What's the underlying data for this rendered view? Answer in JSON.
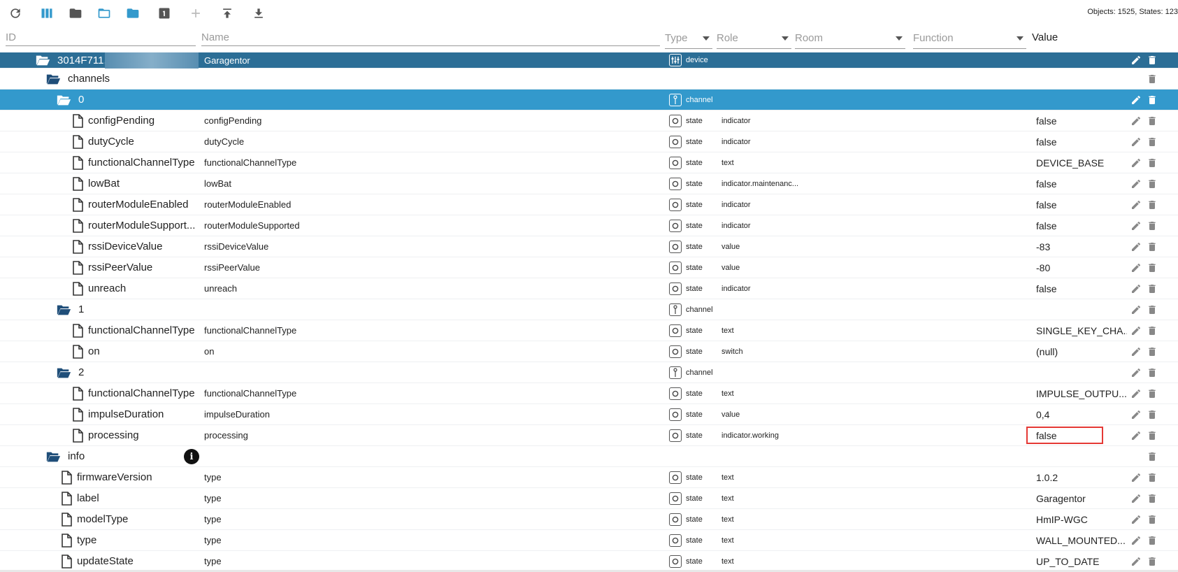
{
  "toolbar": {
    "buttons": [
      {
        "name": "refresh-button",
        "icon": "refresh-icon"
      },
      {
        "name": "columns-button",
        "icon": "columns-icon"
      },
      {
        "name": "folder-button",
        "icon": "folder-icon"
      },
      {
        "name": "folder-open-button",
        "icon": "folder-open-icon"
      },
      {
        "name": "folder-blue-button",
        "icon": "folder-icon"
      },
      {
        "name": "depth-button",
        "icon": "one-box-icon"
      },
      {
        "name": "add-button",
        "icon": "plus-icon"
      },
      {
        "name": "upload-button",
        "icon": "upload-icon"
      },
      {
        "name": "download-button",
        "icon": "download-icon"
      }
    ],
    "object_count": "Objects: 1525, States: 123"
  },
  "header": {
    "id_placeholder": "ID",
    "name_placeholder": "Name",
    "type_label": "Type",
    "role_label": "Role",
    "room_label": "Room",
    "function_label": "Function",
    "value_label": "Value"
  },
  "colors": {
    "device_row": "#2c6e96",
    "selected_row": "#3399cc",
    "folder_icon": "#1f4e79",
    "highlight": "#e53935"
  },
  "rows": [
    {
      "kind": "device",
      "indent": 0,
      "icon": "folder-open-icon",
      "id": "3014F711.",
      "name": "Garagentor",
      "type": "device",
      "type_icon": "device-icon",
      "role": "",
      "value": "",
      "edit": true
    },
    {
      "kind": "folder",
      "indent": 1,
      "icon": "folder-open-icon",
      "id": "channels",
      "name": "",
      "type": "",
      "role": "",
      "value": "",
      "edit": false
    },
    {
      "kind": "selected",
      "indent": 2,
      "icon": "folder-open-icon",
      "id": "0",
      "name": "",
      "type": "channel",
      "type_icon": "channel-icon",
      "role": "",
      "value": "",
      "edit": true
    },
    {
      "kind": "state",
      "indent": 3,
      "icon": "file-icon",
      "id": "configPending",
      "name": "configPending",
      "type": "state",
      "type_icon": "state-icon",
      "role": "indicator",
      "value": "false",
      "edit": true
    },
    {
      "kind": "state",
      "indent": 3,
      "icon": "file-icon",
      "id": "dutyCycle",
      "name": "dutyCycle",
      "type": "state",
      "type_icon": "state-icon",
      "role": "indicator",
      "value": "false",
      "edit": true
    },
    {
      "kind": "state",
      "indent": 3,
      "icon": "file-icon",
      "id": "functionalChannelType",
      "name": "functionalChannelType",
      "type": "state",
      "type_icon": "state-icon",
      "role": "text",
      "value": "DEVICE_BASE",
      "edit": true
    },
    {
      "kind": "state",
      "indent": 3,
      "icon": "file-icon",
      "id": "lowBat",
      "name": "lowBat",
      "type": "state",
      "type_icon": "state-icon",
      "role": "indicator.maintenanc...",
      "value": "false",
      "edit": true
    },
    {
      "kind": "state",
      "indent": 3,
      "icon": "file-icon",
      "id": "routerModuleEnabled",
      "name": "routerModuleEnabled",
      "type": "state",
      "type_icon": "state-icon",
      "role": "indicator",
      "value": "false",
      "edit": true
    },
    {
      "kind": "state",
      "indent": 3,
      "icon": "file-icon",
      "id": "routerModuleSupport...",
      "name": "routerModuleSupported",
      "type": "state",
      "type_icon": "state-icon",
      "role": "indicator",
      "value": "false",
      "edit": true
    },
    {
      "kind": "state",
      "indent": 3,
      "icon": "file-icon",
      "id": "rssiDeviceValue",
      "name": "rssiDeviceValue",
      "type": "state",
      "type_icon": "state-icon",
      "role": "value",
      "value": "-83",
      "edit": true
    },
    {
      "kind": "state",
      "indent": 3,
      "icon": "file-icon",
      "id": "rssiPeerValue",
      "name": "rssiPeerValue",
      "type": "state",
      "type_icon": "state-icon",
      "role": "value",
      "value": "-80",
      "edit": true
    },
    {
      "kind": "state",
      "indent": 3,
      "icon": "file-icon",
      "id": "unreach",
      "name": "unreach",
      "type": "state",
      "type_icon": "state-icon",
      "role": "indicator",
      "value": "false",
      "edit": true
    },
    {
      "kind": "folder",
      "indent": 2,
      "icon": "folder-open-icon",
      "id": "1",
      "name": "",
      "type": "channel",
      "type_icon": "channel-icon",
      "role": "",
      "value": "",
      "edit": true
    },
    {
      "kind": "state",
      "indent": 3,
      "icon": "file-icon",
      "id": "functionalChannelType",
      "name": "functionalChannelType",
      "type": "state",
      "type_icon": "state-icon",
      "role": "text",
      "value": "SINGLE_KEY_CHA...",
      "edit": true
    },
    {
      "kind": "state",
      "indent": 3,
      "icon": "file-icon",
      "id": "on",
      "name": "on",
      "type": "state",
      "type_icon": "state-icon",
      "role": "switch",
      "value": "(null)",
      "edit": true
    },
    {
      "kind": "folder",
      "indent": 2,
      "icon": "folder-open-icon",
      "id": "2",
      "name": "",
      "type": "channel",
      "type_icon": "channel-icon",
      "role": "",
      "value": "",
      "edit": true
    },
    {
      "kind": "state",
      "indent": 3,
      "icon": "file-icon",
      "id": "functionalChannelType",
      "name": "functionalChannelType",
      "type": "state",
      "type_icon": "state-icon",
      "role": "text",
      "value": "IMPULSE_OUTPU...",
      "edit": true
    },
    {
      "kind": "state",
      "indent": 3,
      "icon": "file-icon",
      "id": "impulseDuration",
      "name": "impulseDuration",
      "type": "state",
      "type_icon": "state-icon",
      "role": "value",
      "value": "0,4",
      "edit": true
    },
    {
      "kind": "state",
      "indent": 3,
      "icon": "file-icon",
      "id": "processing",
      "name": "processing",
      "type": "state",
      "type_icon": "state-icon",
      "role": "indicator.working",
      "value": "false",
      "edit": true,
      "highlight": true
    },
    {
      "kind": "folder",
      "indent": 1,
      "icon": "folder-open-icon",
      "id": "info",
      "name": "",
      "type": "",
      "role": "",
      "value": "",
      "edit": false,
      "info_badge": "i"
    },
    {
      "kind": "state",
      "indent": 2,
      "icon": "file-icon",
      "id": "firmwareVersion",
      "name": "type",
      "type": "state",
      "type_icon": "state-icon",
      "role": "text",
      "value": "1.0.2",
      "edit": true
    },
    {
      "kind": "state",
      "indent": 2,
      "icon": "file-icon",
      "id": "label",
      "name": "type",
      "type": "state",
      "type_icon": "state-icon",
      "role": "text",
      "value": "Garagentor",
      "edit": true
    },
    {
      "kind": "state",
      "indent": 2,
      "icon": "file-icon",
      "id": "modelType",
      "name": "type",
      "type": "state",
      "type_icon": "state-icon",
      "role": "text",
      "value": "HmIP-WGC",
      "edit": true
    },
    {
      "kind": "state",
      "indent": 2,
      "icon": "file-icon",
      "id": "type",
      "name": "type",
      "type": "state",
      "type_icon": "state-icon",
      "role": "text",
      "value": "WALL_MOUNTED...",
      "edit": true
    },
    {
      "kind": "state",
      "indent": 2,
      "icon": "file-icon",
      "id": "updateState",
      "name": "type",
      "type": "state",
      "type_icon": "state-icon",
      "role": "text",
      "value": "UP_TO_DATE",
      "edit": true
    }
  ]
}
